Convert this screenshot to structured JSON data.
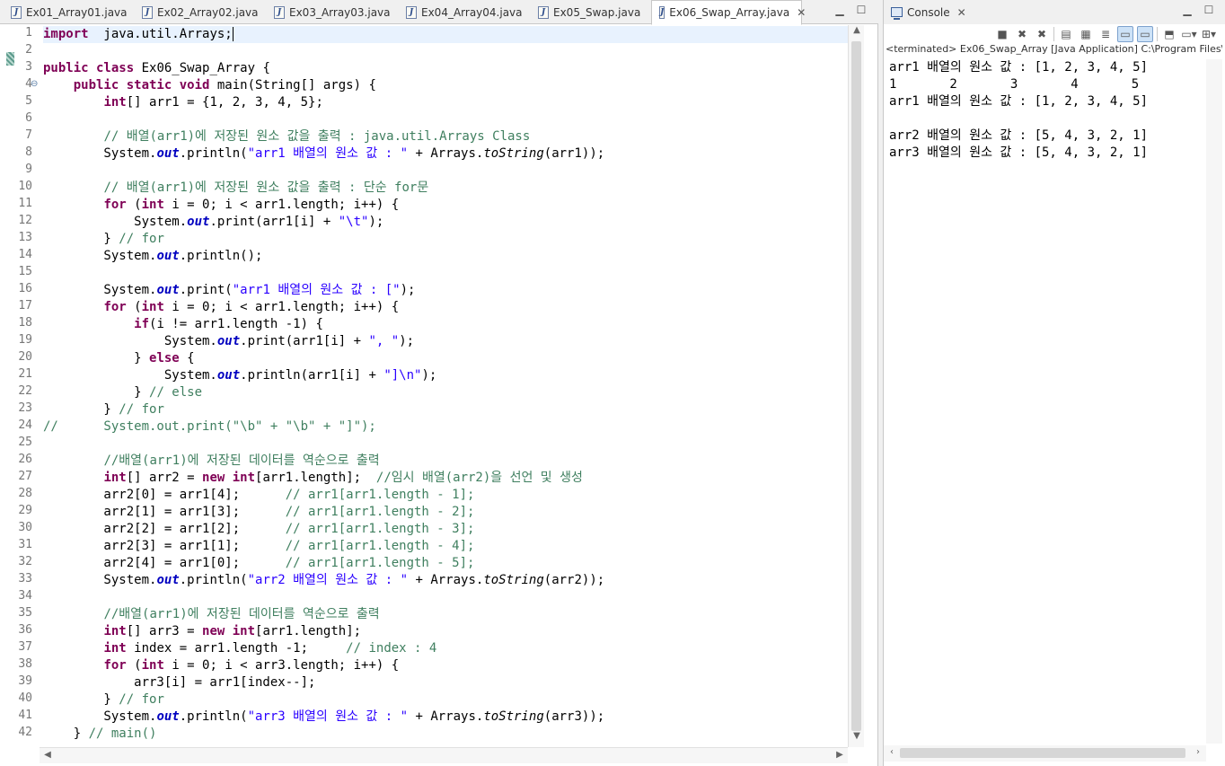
{
  "editor": {
    "tabs": [
      {
        "label": "Ex01_Array01.java"
      },
      {
        "label": "Ex02_Array02.java"
      },
      {
        "label": "Ex03_Array03.java"
      },
      {
        "label": "Ex04_Array04.java"
      },
      {
        "label": "Ex05_Swap.java"
      },
      {
        "label": "Ex06_Swap_Array.java",
        "active": true
      }
    ],
    "line_numbers": [
      "1",
      "2",
      "3",
      "4",
      "5",
      "6",
      "7",
      "8",
      "9",
      "10",
      "11",
      "12",
      "13",
      "14",
      "15",
      "16",
      "17",
      "18",
      "19",
      "20",
      "21",
      "22",
      "23",
      "24",
      "25",
      "26",
      "27",
      "28",
      "29",
      "30",
      "31",
      "32",
      "33",
      "34",
      "35",
      "36",
      "37",
      "38",
      "39",
      "40",
      "41",
      "42"
    ],
    "current_line": 1,
    "lines": [
      [
        [
          "kw",
          "import"
        ],
        [
          "",
          "  java.util.Arrays;"
        ]
      ],
      [],
      [
        [
          "kw",
          "public class"
        ],
        [
          "",
          " Ex06_Swap_Array {"
        ]
      ],
      [
        [
          "",
          "    "
        ],
        [
          "kw",
          "public static void"
        ],
        [
          "",
          " main(String[] args) {"
        ]
      ],
      [
        [
          "",
          "        "
        ],
        [
          "kw",
          "int"
        ],
        [
          "",
          "[] arr1 = {1, 2, 3, 4, 5};"
        ]
      ],
      [],
      [
        [
          "",
          "        "
        ],
        [
          "cm",
          "// 배열(arr1)에 저장된 원소 값을 출력 : java.util.Arrays Class"
        ]
      ],
      [
        [
          "",
          "        System."
        ],
        [
          "fd",
          "out"
        ],
        [
          "",
          ".println("
        ],
        [
          "st",
          "\"arr1 배열의 원소 값 : \""
        ],
        [
          "",
          " + Arrays."
        ],
        [
          "sm",
          "toString"
        ],
        [
          "",
          "(arr1));"
        ]
      ],
      [],
      [
        [
          "",
          "        "
        ],
        [
          "cm",
          "// 배열(arr1)에 저장된 원소 값을 출력 : 단순 for문"
        ]
      ],
      [
        [
          "",
          "        "
        ],
        [
          "kw",
          "for"
        ],
        [
          "",
          " ("
        ],
        [
          "kw",
          "int"
        ],
        [
          "",
          " i = 0; i < arr1.length; i++) {"
        ]
      ],
      [
        [
          "",
          "            System."
        ],
        [
          "fd",
          "out"
        ],
        [
          "",
          ".print(arr1[i] + "
        ],
        [
          "st",
          "\"\\t\""
        ],
        [
          "",
          ");"
        ]
      ],
      [
        [
          "",
          "        } "
        ],
        [
          "cm",
          "// for"
        ]
      ],
      [
        [
          "",
          "        System."
        ],
        [
          "fd",
          "out"
        ],
        [
          "",
          ".println();"
        ]
      ],
      [],
      [
        [
          "",
          "        System."
        ],
        [
          "fd",
          "out"
        ],
        [
          "",
          ".print("
        ],
        [
          "st",
          "\"arr1 배열의 원소 값 : [\""
        ],
        [
          "",
          ");"
        ]
      ],
      [
        [
          "",
          "        "
        ],
        [
          "kw",
          "for"
        ],
        [
          "",
          " ("
        ],
        [
          "kw",
          "int"
        ],
        [
          "",
          " i = 0; i < arr1.length; i++) {"
        ]
      ],
      [
        [
          "",
          "            "
        ],
        [
          "kw",
          "if"
        ],
        [
          "",
          "(i != arr1.length -1) {"
        ]
      ],
      [
        [
          "",
          "                System."
        ],
        [
          "fd",
          "out"
        ],
        [
          "",
          ".print(arr1[i] + "
        ],
        [
          "st",
          "\", \""
        ],
        [
          "",
          ");"
        ]
      ],
      [
        [
          "",
          "            } "
        ],
        [
          "kw",
          "else"
        ],
        [
          "",
          " {"
        ]
      ],
      [
        [
          "",
          "                System."
        ],
        [
          "fd",
          "out"
        ],
        [
          "",
          ".println(arr1[i] + "
        ],
        [
          "st",
          "\"]\\n\""
        ],
        [
          "",
          ");"
        ]
      ],
      [
        [
          "",
          "            } "
        ],
        [
          "cm",
          "// else"
        ]
      ],
      [
        [
          "",
          "        } "
        ],
        [
          "cm",
          "// for"
        ]
      ],
      [
        [
          "cm",
          "//      System.out.print(\"\\b\" + \"\\b\" + \"]\");"
        ]
      ],
      [],
      [
        [
          "",
          "        "
        ],
        [
          "cm",
          "//배열(arr1)에 저장된 데이터를 역순으로 출력"
        ]
      ],
      [
        [
          "",
          "        "
        ],
        [
          "kw",
          "int"
        ],
        [
          "",
          "[] arr2 = "
        ],
        [
          "kw",
          "new int"
        ],
        [
          "",
          "[arr1.length];  "
        ],
        [
          "cm",
          "//임시 배열(arr2)을 선언 및 생성"
        ]
      ],
      [
        [
          "",
          "        arr2[0] = arr1[4];      "
        ],
        [
          "cm",
          "// arr1[arr1.length - 1];"
        ]
      ],
      [
        [
          "",
          "        arr2[1] = arr1[3];      "
        ],
        [
          "cm",
          "// arr1[arr1.length - 2];"
        ]
      ],
      [
        [
          "",
          "        arr2[2] = arr1[2];      "
        ],
        [
          "cm",
          "// arr1[arr1.length - 3];"
        ]
      ],
      [
        [
          "",
          "        arr2[3] = arr1[1];      "
        ],
        [
          "cm",
          "// arr1[arr1.length - 4];"
        ]
      ],
      [
        [
          "",
          "        arr2[4] = arr1[0];      "
        ],
        [
          "cm",
          "// arr1[arr1.length - 5];"
        ]
      ],
      [
        [
          "",
          "        System."
        ],
        [
          "fd",
          "out"
        ],
        [
          "",
          ".println("
        ],
        [
          "st",
          "\"arr2 배열의 원소 값 : \""
        ],
        [
          "",
          " + Arrays."
        ],
        [
          "sm",
          "toString"
        ],
        [
          "",
          "(arr2));"
        ]
      ],
      [],
      [
        [
          "",
          "        "
        ],
        [
          "cm",
          "//배열(arr1)에 저장된 데이터를 역순으로 출력"
        ]
      ],
      [
        [
          "",
          "        "
        ],
        [
          "kw",
          "int"
        ],
        [
          "",
          "[] arr3 = "
        ],
        [
          "kw",
          "new int"
        ],
        [
          "",
          "[arr1.length];"
        ]
      ],
      [
        [
          "",
          "        "
        ],
        [
          "kw",
          "int"
        ],
        [
          "",
          " index = arr1.length -1;     "
        ],
        [
          "cm",
          "// index : 4"
        ]
      ],
      [
        [
          "",
          "        "
        ],
        [
          "kw",
          "for"
        ],
        [
          "",
          " ("
        ],
        [
          "kw",
          "int"
        ],
        [
          "",
          " i = 0; i < arr3.length; i++) {"
        ]
      ],
      [
        [
          "",
          "            arr3[i] = arr1[index--];"
        ]
      ],
      [
        [
          "",
          "        } "
        ],
        [
          "cm",
          "// for"
        ]
      ],
      [
        [
          "",
          "        System."
        ],
        [
          "fd",
          "out"
        ],
        [
          "",
          ".println("
        ],
        [
          "st",
          "\"arr3 배열의 원소 값 : \""
        ],
        [
          "",
          " + Arrays."
        ],
        [
          "sm",
          "toString"
        ],
        [
          "",
          "(arr3));"
        ]
      ],
      [
        [
          "",
          "    } "
        ],
        [
          "cm",
          "// main()"
        ]
      ]
    ]
  },
  "console": {
    "tab_label": "Console",
    "status": "<terminated> Ex06_Swap_Array [Java Application] C:\\Program Files\\",
    "output": [
      "arr1 배열의 원소 값 : [1, 2, 3, 4, 5]",
      "1       2       3       4       5",
      "arr1 배열의 원소 값 : [1, 2, 3, 4, 5]",
      "",
      "arr2 배열의 원소 값 : [5, 4, 3, 2, 1]",
      "arr3 배열의 원소 값 : [5, 4, 3, 2, 1]"
    ],
    "toolbar_icons": [
      "terminate-icon",
      "remove-launch-icon",
      "remove-all-icon",
      "clear-console-icon",
      "scroll-lock-icon",
      "word-wrap-icon",
      "show-on-stdout-icon",
      "show-on-stderr-icon",
      "pin-console-icon",
      "display-console-icon",
      "open-console-icon"
    ]
  }
}
